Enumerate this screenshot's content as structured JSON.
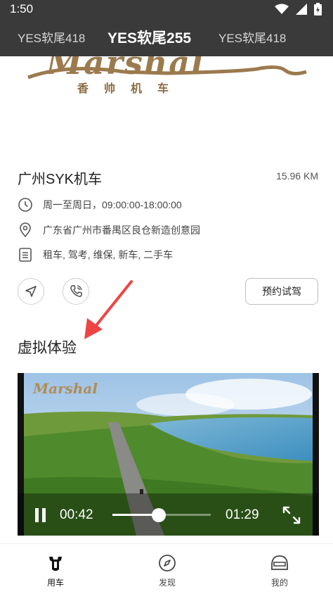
{
  "status_bar": {
    "time": "1:50"
  },
  "tabs": [
    {
      "label": "YES软尾418",
      "active": false
    },
    {
      "label": "YES软尾255",
      "active": true
    },
    {
      "label": "YES软尾418",
      "active": false
    }
  ],
  "brand": {
    "logo_text": "Marshal",
    "logo_subtitle": "香帅机车",
    "logo_color": "#9b7a4e"
  },
  "dealer": {
    "name": "广州SYK机车",
    "distance": "15.96 KM",
    "hours": "周一至周日，09:00:00-18:00:00",
    "address": "广东省广州市番禺区良仓新造创意园",
    "services": "租车, 驾考, 维保, 新车, 二手车",
    "book_button": "预约试驾"
  },
  "virtual_experience": {
    "title": "虚拟体验",
    "video": {
      "watermark": "Marshal",
      "current_time": "00:42",
      "duration": "01:29",
      "progress": 0.47,
      "state": "playing"
    }
  },
  "bottom_nav": [
    {
      "label": "用车",
      "icon": "motorcycle-icon",
      "active": true
    },
    {
      "label": "发现",
      "icon": "compass-icon",
      "active": false
    },
    {
      "label": "我的",
      "icon": "helmet-icon",
      "active": false
    }
  ],
  "annotation": {
    "color": "#ee4444"
  }
}
